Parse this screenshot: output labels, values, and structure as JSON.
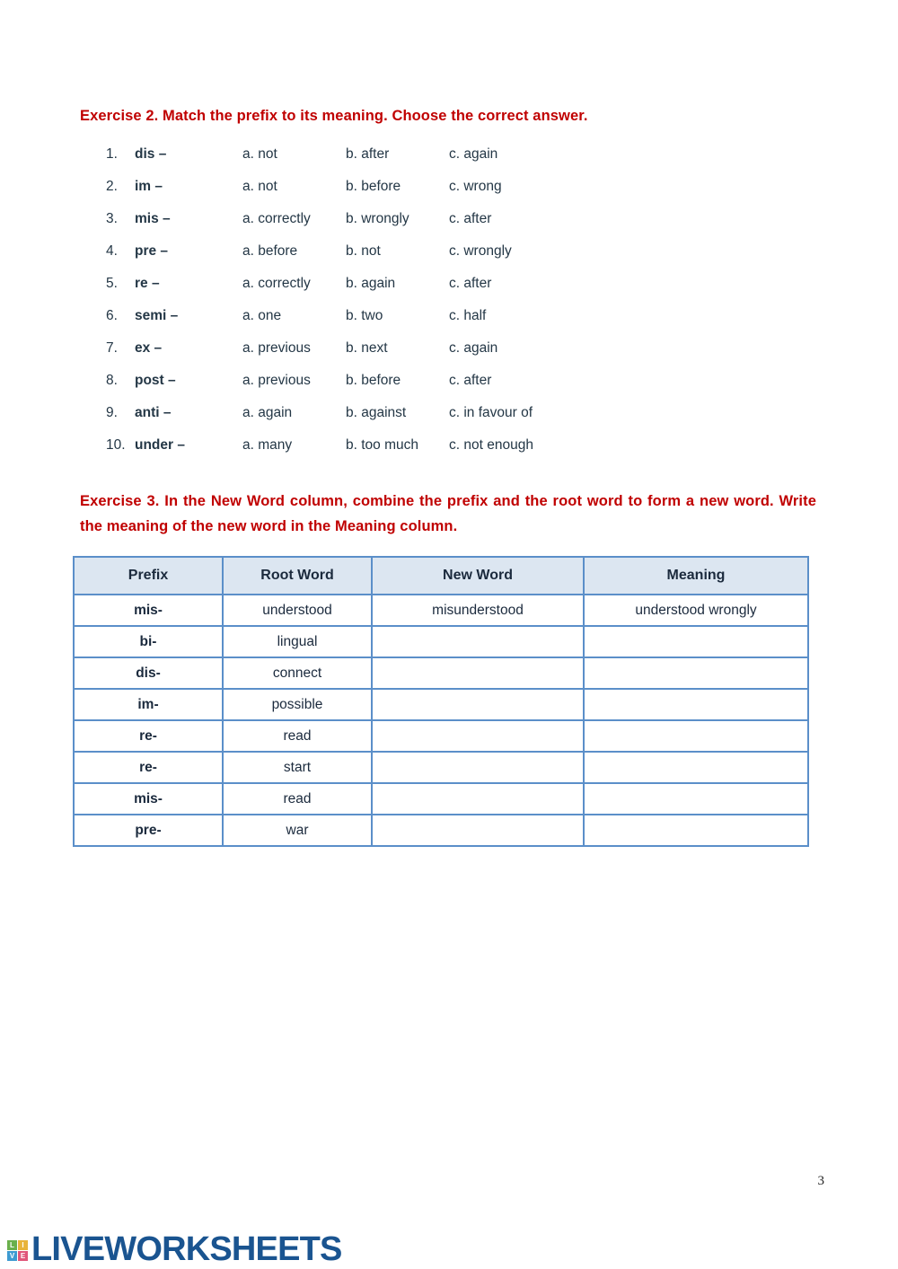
{
  "exercise2": {
    "heading": "Exercise 2. Match the prefix to its meaning. Choose the correct answer.",
    "items": [
      {
        "num": "1.",
        "prefix": "dis –",
        "a": "a. not",
        "b": "b. after",
        "c": "c. again"
      },
      {
        "num": "2.",
        "prefix": "im –",
        "a": "a. not",
        "b": "b. before",
        "c": "c. wrong"
      },
      {
        "num": "3.",
        "prefix": "mis –",
        "a": "a. correctly",
        "b": "b. wrongly",
        "c": "c. after"
      },
      {
        "num": "4.",
        "prefix": "pre –",
        "a": "a. before",
        "b": "b. not",
        "c": "c. wrongly"
      },
      {
        "num": "5.",
        "prefix": "re –",
        "a": "a. correctly",
        "b": "b. again",
        "c": "c. after"
      },
      {
        "num": "6.",
        "prefix": "semi –",
        "a": "a. one",
        "b": "b. two",
        "c": "c. half"
      },
      {
        "num": "7.",
        "prefix": "ex –",
        "a": "a. previous",
        "b": "b. next",
        "c": "c. again"
      },
      {
        "num": "8.",
        "prefix": "post –",
        "a": "a. previous",
        "b": "b. before",
        "c": "c. after"
      },
      {
        "num": "9.",
        "prefix": "anti –",
        "a": "a. again",
        "b": "b. against",
        "c": "c. in favour of"
      },
      {
        "num": "10.",
        "prefix": "under –",
        "a": "a. many",
        "b": "b. too much",
        "c": "c. not enough"
      }
    ]
  },
  "exercise3": {
    "heading": "Exercise 3. In the New Word column, combine the prefix and the root word to form a new word. Write the meaning of the new word in the Meaning column.",
    "table": {
      "headers": [
        "Prefix",
        "Root Word",
        "New Word",
        "Meaning"
      ],
      "rows": [
        {
          "prefix": "mis-",
          "root": "understood",
          "new": "misunderstood",
          "meaning": "understood wrongly"
        },
        {
          "prefix": "bi-",
          "root": "lingual",
          "new": "",
          "meaning": ""
        },
        {
          "prefix": "dis-",
          "root": "connect",
          "new": "",
          "meaning": ""
        },
        {
          "prefix": "im-",
          "root": "possible",
          "new": "",
          "meaning": ""
        },
        {
          "prefix": "re-",
          "root": "read",
          "new": "",
          "meaning": ""
        },
        {
          "prefix": "re-",
          "root": "start",
          "new": "",
          "meaning": ""
        },
        {
          "prefix": "mis-",
          "root": "read",
          "new": "",
          "meaning": ""
        },
        {
          "prefix": "pre-",
          "root": "war",
          "new": "",
          "meaning": ""
        }
      ]
    }
  },
  "footer": {
    "page_number": "3",
    "logo_text": "LIVEWORKSHEETS",
    "logo_squares": [
      "L",
      "I",
      "V",
      "E"
    ]
  },
  "colors": {
    "heading_red": "#C00000",
    "table_border_blue": "#5b8fc9",
    "table_header_fill": "#dce6f1",
    "body_text": "#1b2a3d",
    "logo_navy": "#1a5490"
  }
}
